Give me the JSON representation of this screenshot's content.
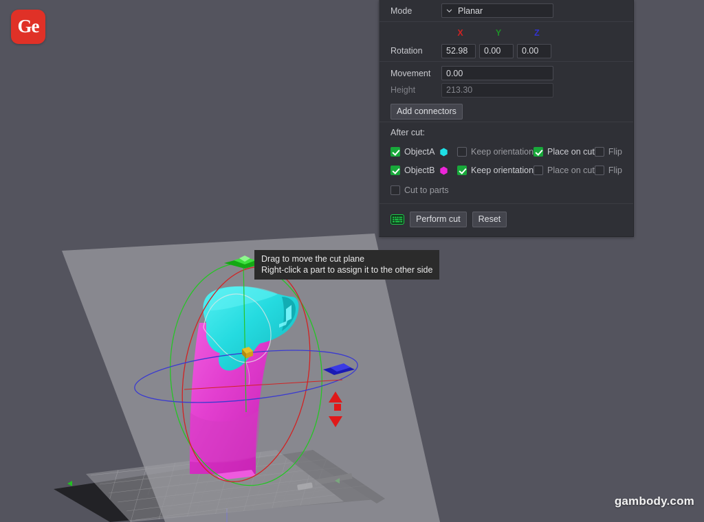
{
  "app": {
    "logo_text": "Ge",
    "watermark": "gambody.com",
    "background_color": "#54545e"
  },
  "tooltip": {
    "line1": "Drag to move the cut plane",
    "line2": "Right-click a part to assign it to the other side"
  },
  "panel": {
    "mode": {
      "label": "Mode",
      "value": "Planar",
      "options": [
        "Planar"
      ]
    },
    "axes": {
      "x": "X",
      "y": "Y",
      "z": "Z",
      "x_color": "#cf2222",
      "y_color": "#1f8f28",
      "z_color": "#3232cf"
    },
    "rotation": {
      "label": "Rotation",
      "x": "52.98",
      "y": "0.00",
      "z": "0.00"
    },
    "movement": {
      "label": "Movement",
      "value": "0.00"
    },
    "height": {
      "label": "Height",
      "value": "213.30",
      "readonly": true
    },
    "add_connectors_label": "Add connectors",
    "after_cut": {
      "title": "After cut:",
      "rows": [
        {
          "name": "ObjectA",
          "enabled": true,
          "swatch_color": "#1ee0e6",
          "keep_orientation": {
            "label": "Keep orientation",
            "checked": false
          },
          "place_on_cut": {
            "label": "Place on cut",
            "checked": true
          },
          "flip": {
            "label": "Flip",
            "checked": false
          }
        },
        {
          "name": "ObjectB",
          "enabled": true,
          "swatch_color": "#ec25d9",
          "keep_orientation": {
            "label": "Keep orientation",
            "checked": true
          },
          "place_on_cut": {
            "label": "Place on cut",
            "checked": false
          },
          "flip": {
            "label": "Flip",
            "checked": false
          }
        }
      ],
      "cut_to_parts": {
        "label": "Cut to parts",
        "checked": false
      }
    },
    "actions": {
      "keyboard_icon": "keyboard-icon",
      "perform_cut_label": "Perform cut",
      "reset_label": "Reset"
    }
  },
  "viewport": {
    "object_a_color": "#1ee0e6",
    "object_b_color": "#e040d0",
    "cut_plane_color": "#9b9b9b",
    "build_plate_color": "#2a2a2a",
    "gizmo": {
      "x_ring_color": "#d02020",
      "y_ring_color": "#22c022",
      "z_ring_color": "#3a3ad0",
      "up_arrow_color": "#22c022",
      "right_arrow_color": "#2020d0",
      "red_arrow_color": "#e01818",
      "center_handle_color": "#d8a81c"
    }
  }
}
